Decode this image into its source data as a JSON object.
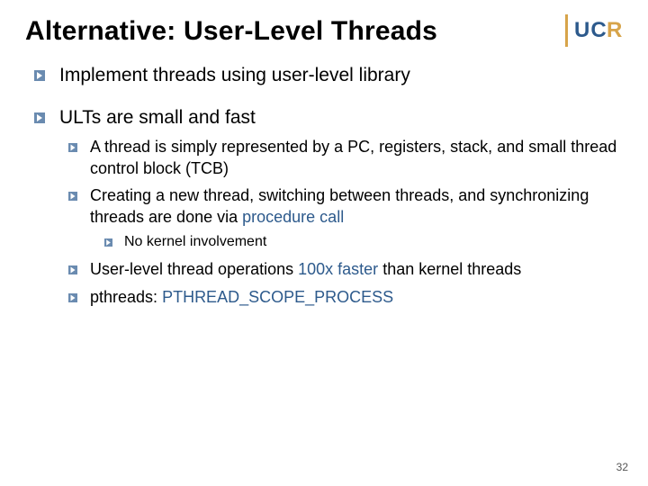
{
  "title": "Alternative: User-Level Threads",
  "logo": {
    "left": "UC",
    "right": "R"
  },
  "b1": {
    "text": "Implement threads using user-level library"
  },
  "b2": {
    "text": "ULTs are small and fast",
    "c1": "A thread is simply represented by a PC, registers, stack, and small thread control block (TCB)",
    "c2a": "Creating a new thread, switching between threads, and synchronizing threads are done via ",
    "c2b": "procedure call",
    "c2_g1": "No kernel involvement",
    "c3a": "User-level thread operations ",
    "c3b": "100x faster",
    "c3c": " than kernel threads",
    "c4a": "pthreads: ",
    "c4b": "PTHREAD_SCOPE_PROCESS"
  },
  "page": "32"
}
